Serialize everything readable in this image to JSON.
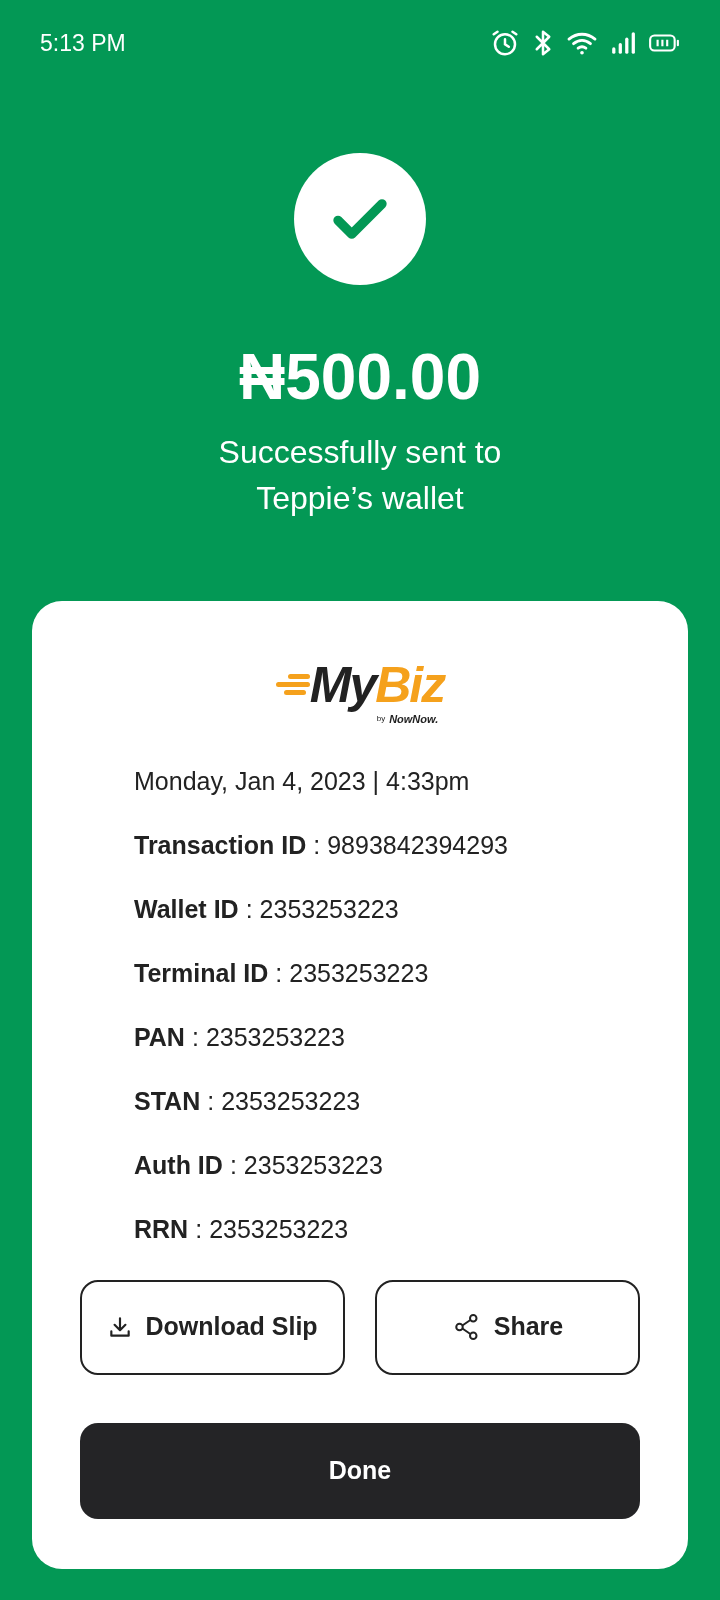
{
  "status_bar": {
    "time": "5:13 PM"
  },
  "amount": "₦500.00",
  "message_lines": [
    "Successfully sent to",
    "Teppie’s wallet"
  ],
  "logo": {
    "main": "My",
    "accent": "Biz",
    "by": "by",
    "brand": "NowNow."
  },
  "date_time": "Monday, Jan 4, 2023 | 4:33pm",
  "details": [
    {
      "label": "Transaction ID",
      "separator": ":",
      "value": "9893842394293"
    },
    {
      "label": "Wallet ID",
      "separator": ":",
      "value": "2353253223"
    },
    {
      "label": "Terminal ID",
      "separator": ":",
      "value": "2353253223"
    },
    {
      "label": "PAN",
      "separator": ":",
      "value": "2353253223"
    },
    {
      "label": "STAN",
      "separator": ":",
      "value": "2353253223"
    },
    {
      "label": "Auth ID",
      "separator": ":",
      "value": "2353253223"
    },
    {
      "label": "RRN",
      "separator": ":",
      "value": "2353253223"
    }
  ],
  "actions": [
    {
      "kind": "download",
      "label": "Download Slip"
    },
    {
      "kind": "share",
      "label": "Share"
    }
  ],
  "done_button": "Done"
}
